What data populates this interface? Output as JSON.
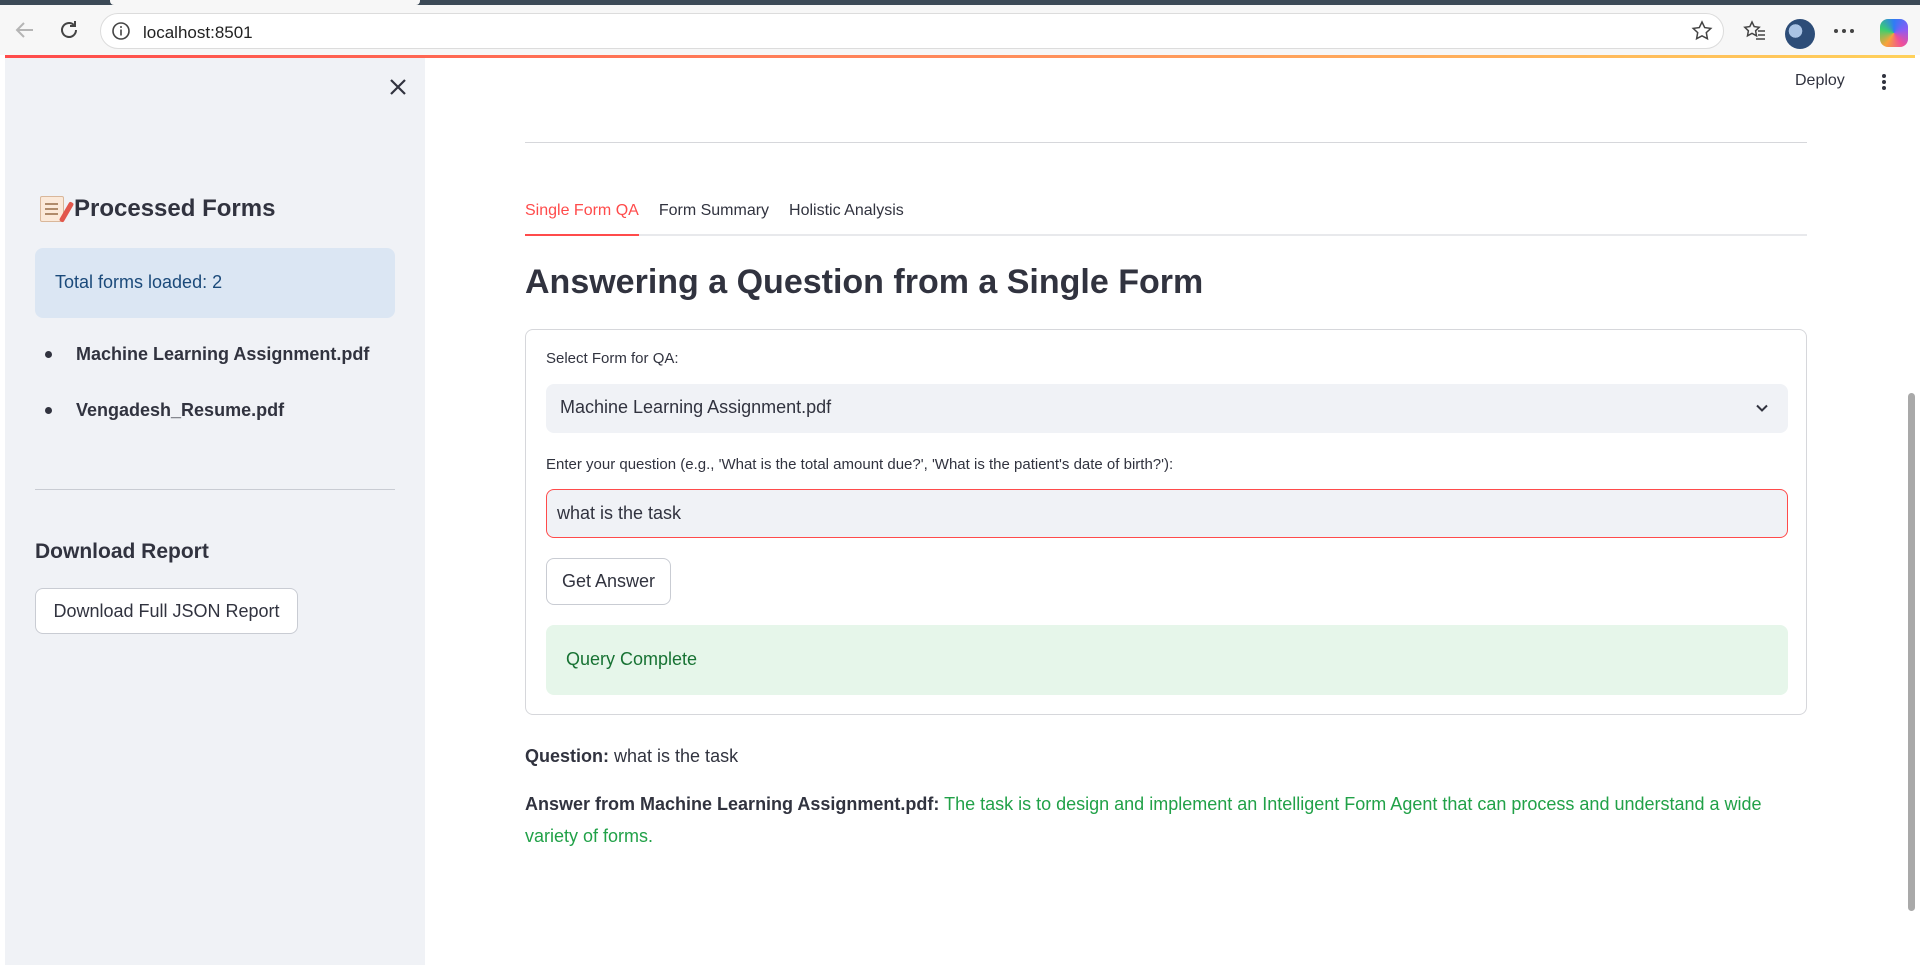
{
  "browser": {
    "url": "localhost:8501"
  },
  "header": {
    "deploy_label": "Deploy"
  },
  "sidebar": {
    "title": "Processed Forms",
    "info_text": "Total forms loaded: 2",
    "files": [
      "Machine Learning Assignment.pdf",
      "Vengadesh_Resume.pdf"
    ],
    "download_heading": "Download Report",
    "download_button": "Download Full JSON Report"
  },
  "main": {
    "tabs": [
      {
        "label": "Single Form QA",
        "active": true
      },
      {
        "label": "Form Summary",
        "active": false
      },
      {
        "label": "Holistic Analysis",
        "active": false
      }
    ],
    "title": "Answering a Question from a Single Form",
    "form": {
      "select_label": "Select Form for QA:",
      "selected_form": "Machine Learning Assignment.pdf",
      "question_label": "Enter your question (e.g., 'What is the total amount due?', 'What is the patient's date of birth?'):",
      "question_value": "what is the task",
      "submit_label": "Get Answer",
      "status_text": "Query Complete"
    },
    "result": {
      "question_label": "Question:",
      "question_text": "what is the task",
      "answer_label": "Answer from Machine Learning Assignment.pdf:",
      "answer_text": "The task is to design and implement an Intelligent Form Agent that can process and understand a wide variety of forms."
    }
  },
  "colors": {
    "accent": "#ff4b4b",
    "sidebar_bg": "#f0f2f6",
    "info_bg": "#dbe6f3",
    "success_bg": "#e6f6ea",
    "success_text": "#177233",
    "answer_text": "#21a148"
  },
  "icons": [
    "back-arrow-icon",
    "reload-icon",
    "info-icon",
    "star-icon",
    "favorites-icon",
    "more-icon",
    "close-icon",
    "memo-icon",
    "chevron-down-icon",
    "kebab-menu-icon"
  ]
}
